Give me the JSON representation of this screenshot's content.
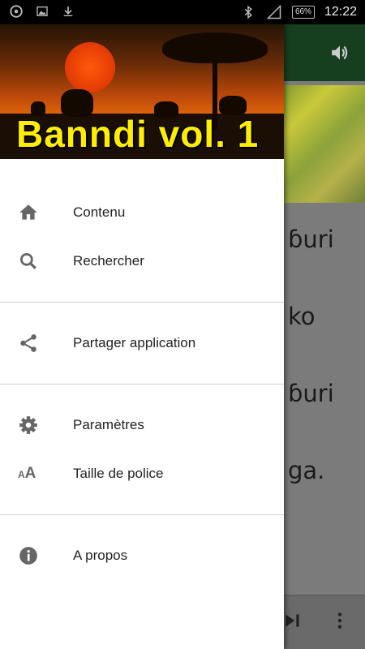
{
  "status_bar": {
    "battery": "66%",
    "time": "12:22"
  },
  "drawer": {
    "header_title": "Banndi vol. 1",
    "sections": [
      [
        {
          "label": "Contenu",
          "icon": "home-icon"
        },
        {
          "label": "Rechercher",
          "icon": "search-icon"
        }
      ],
      [
        {
          "label": "Partager application",
          "icon": "share-icon"
        }
      ],
      [
        {
          "label": "Paramètres",
          "icon": "gear-icon"
        },
        {
          "label": "Taille de police",
          "icon": "font-size-icon"
        }
      ],
      [
        {
          "label": "A propos",
          "icon": "info-icon"
        }
      ]
    ]
  },
  "background": {
    "lines": [
      "ɓuri",
      "ko",
      "ɓuri",
      "ga."
    ]
  }
}
